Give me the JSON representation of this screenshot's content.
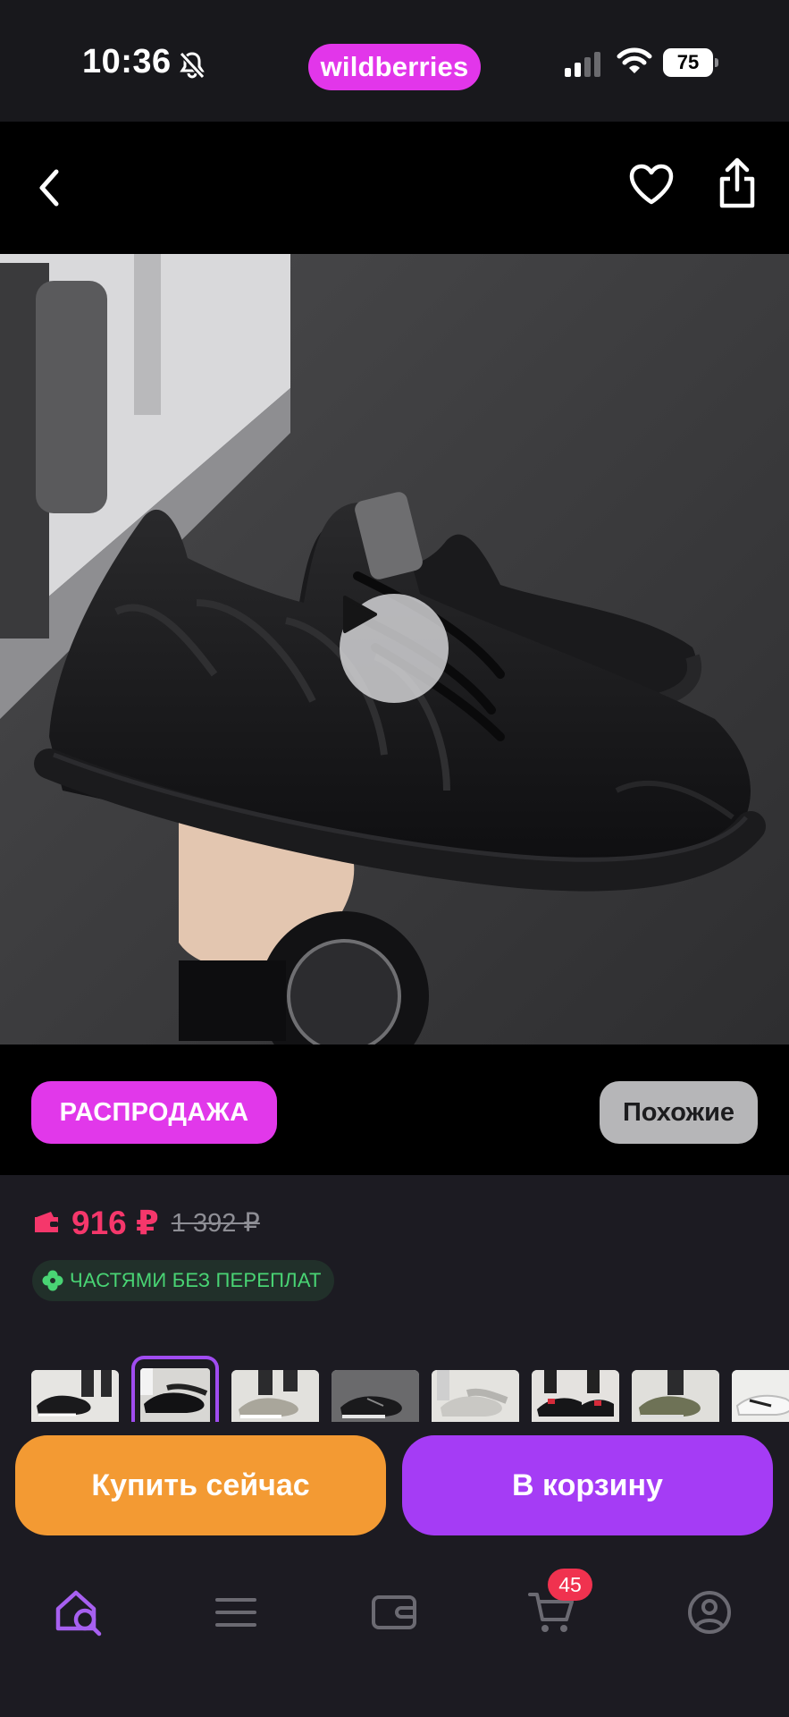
{
  "status_bar": {
    "time": "10:36",
    "brand": "wildberries",
    "battery": "75",
    "icons": [
      "bell-muted-icon",
      "signal-icon",
      "wifi-icon",
      "battery-icon"
    ]
  },
  "top_nav": {
    "icons": [
      "chevron-left-icon",
      "heart-icon",
      "share-icon"
    ]
  },
  "product": {
    "media_icon": "play-icon",
    "chips": {
      "sale": "РАСПРОДАЖА",
      "similar": "Похожие"
    },
    "price": {
      "current": "916 ₽",
      "old": "1 392 ₽",
      "icon": "wallet-icon"
    },
    "installments": {
      "label": "ЧАСТЯМИ БЕЗ ПЕРЕПЛАТ",
      "icon": "clover-icon"
    },
    "thumbnails_selected_index": 1
  },
  "actions": {
    "buy_now": "Купить сейчас",
    "add_to_cart": "В корзину"
  },
  "tab_bar": {
    "items": [
      "home-search-icon",
      "catalog-icon",
      "wallet-icon",
      "cart-icon",
      "profile-icon"
    ],
    "cart_count": "45",
    "active_color": "#a760f0"
  },
  "colors": {
    "brand": "#e236ea",
    "price": "#f5376b",
    "buy_now": "#f39a33",
    "add_to_cart": "#a53cf5",
    "installments": "#49d474"
  }
}
